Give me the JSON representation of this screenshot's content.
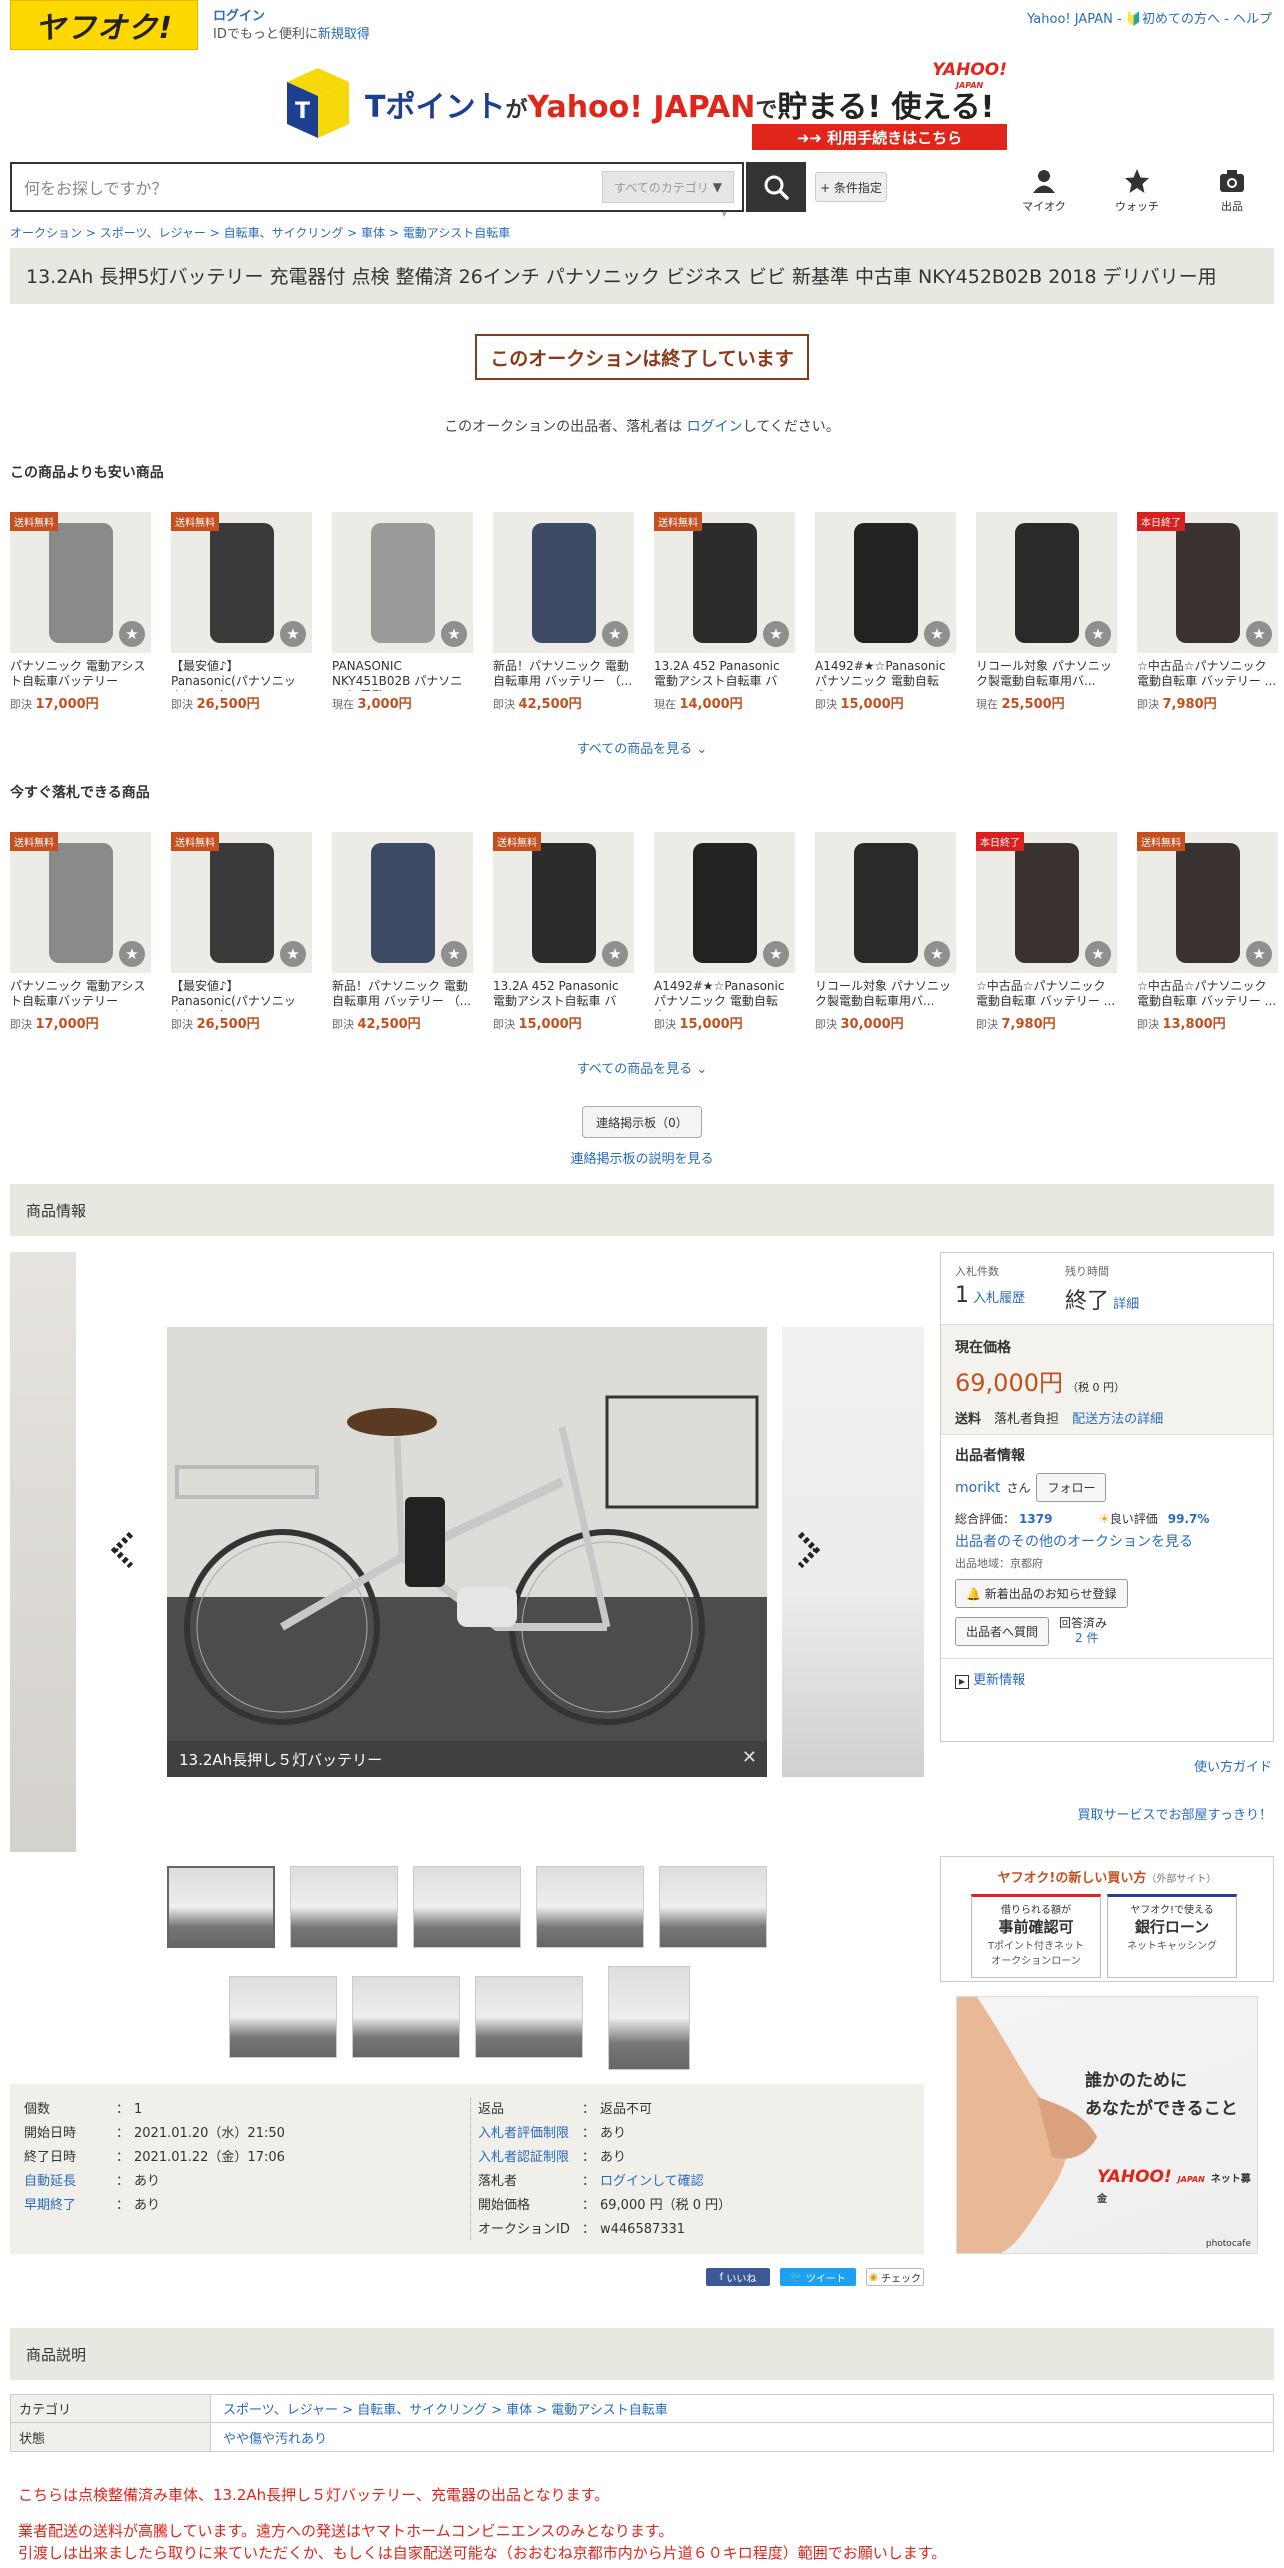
{
  "header": {
    "logo": "ヤフオク!",
    "login": "ログイン",
    "login_sub_prefix": "IDでもっと便利に",
    "login_sub_link": "新規取得",
    "links": "Yahoo! JAPAN - 🔰初めての方へ - ヘルプ"
  },
  "banner": {
    "tpoint": "Tポイント",
    "ga": "が",
    "yahoo": "Yahoo! JAPAN",
    "tame": "で",
    "tamaru": "貯まる! 使える!",
    "yahoo_logo": "YAHOO!",
    "yahoo_logo_sub": "JAPAN",
    "cta": "➜➜ 利用手続きはこちら"
  },
  "search": {
    "placeholder": "何をお探しですか？",
    "category": "すべてのカテゴリ",
    "conditions": "+ 条件指定"
  },
  "nav": {
    "mypage": "マイオク",
    "watch": "ウォッチ",
    "sell": "出品"
  },
  "breadcrumb": [
    "オークション",
    "スポーツ、レジャー",
    "自転車、サイクリング",
    "車体",
    "電動アシスト自転車"
  ],
  "title": "13.2Ah 長押5灯バッテリー 充電器付 点検 整備済 26インチ パナソニック ビジネス ビビ 新基準 中古車 NKY452B02B 2018 デリバリー用",
  "ended_label": "このオークションは終了しています",
  "notice": {
    "prefix": "このオークションの出品者、落札者は",
    "link": "ログイン",
    "suffix": "してください。"
  },
  "cheaper": {
    "heading": "この商品よりも安い商品",
    "see_all": "すべての商品を見る",
    "items": [
      {
        "badge": "送料無料",
        "name": "パナソニック 電動アシスト自転車バッテリー NKY...",
        "plabel": "即決",
        "price": "17,000円",
        "color": "#8a8a88"
      },
      {
        "badge": "送料無料",
        "name": "【最安値♪】Panasonic(パナソニック) リチウムイ...",
        "plabel": "即決",
        "price": "26,500円",
        "color": "#3a3a3a"
      },
      {
        "badge": "",
        "name": "PANASONIC NKY451B02B パナソニック 電動 ...",
        "plabel": "現在",
        "price": "3,000円",
        "color": "#9a9a98"
      },
      {
        "badge": "",
        "name": "新品！パナソニック 電動自転車用 バッテリー （...",
        "plabel": "即決",
        "price": "42,500円",
        "color": "#3c4a66"
      },
      {
        "badge": "送料無料",
        "name": "13.2A 452 Panasonic 電動アシスト自転車 バッ...",
        "plabel": "現在",
        "price": "14,000円",
        "color": "#2c2c2c"
      },
      {
        "badge": "",
        "name": "A1492#★☆Panasonic パナソニック 電動自転車...",
        "plabel": "即決",
        "price": "15,000円",
        "color": "#222"
      },
      {
        "badge": "",
        "name": "リコール対象 パナソニック製電動自転車用バ...",
        "plabel": "現在",
        "price": "25,500円",
        "color": "#2a2a2a"
      },
      {
        "badge": "本日終了",
        "name": "☆中古品☆パナソニック 電動自転車 バッテリー ...",
        "plabel": "即決",
        "price": "7,980円",
        "color": "#3a3230"
      }
    ]
  },
  "buynow": {
    "heading": "今すぐ落札できる商品",
    "see_all": "すべての商品を見る",
    "items": [
      {
        "badge": "送料無料",
        "name": "パナソニック 電動アシスト自転車バッテリー NKY...",
        "plabel": "即決",
        "price": "17,000円",
        "color": "#8a8a88"
      },
      {
        "badge": "送料無料",
        "name": "【最安値♪】Panasonic(パナソニック) リチウムイ...",
        "plabel": "即決",
        "price": "26,500円",
        "color": "#3a3a3a"
      },
      {
        "badge": "",
        "name": "新品！パナソニック 電動自転車用 バッテリー （...",
        "plabel": "即決",
        "price": "42,500円",
        "color": "#3c4a66"
      },
      {
        "badge": "送料無料",
        "name": "13.2A 452 Panasonic 電動アシスト自転車 バッ...",
        "plabel": "即決",
        "price": "15,000円",
        "color": "#2c2c2c"
      },
      {
        "badge": "",
        "name": "A1492#★☆Panasonic パナソニック 電動自転車...",
        "plabel": "即決",
        "price": "15,000円",
        "color": "#222"
      },
      {
        "badge": "",
        "name": "リコール対象 パナソニック製電動自転車用バ...",
        "plabel": "即決",
        "price": "30,000円",
        "color": "#2a2a2a"
      },
      {
        "badge": "本日終了",
        "name": "☆中古品☆パナソニック 電動自転車 バッテリー ...",
        "plabel": "即決",
        "price": "7,980円",
        "color": "#3a3230"
      },
      {
        "badge": "送料無料",
        "name": "☆中古品☆パナソニック 電動自転車 バッテリー ...",
        "plabel": "即決",
        "price": "13,800円",
        "color": "#3a3230"
      }
    ]
  },
  "bbs": {
    "button": "連絡掲示板（0）",
    "link": "連絡掲示板の説明を見る"
  },
  "item_info_heading": "商品情報",
  "photo_caption": "13.2Ah長押し５灯バッテリー",
  "panel": {
    "bids_label": "入札件数",
    "bids": "1",
    "bid_history": "入札履歴",
    "time_label": "残り時間",
    "time": "終了",
    "detail": "詳細",
    "price_label": "現在価格",
    "price": "69,000円",
    "tax": "（税 0 円）",
    "shipping_label": "送料",
    "shipping_val": "落札者負担",
    "shipping_link": "配送方法の詳細",
    "seller_heading": "出品者情報",
    "seller_name": "morikt",
    "seller_san": "さん",
    "follow": "フォロー",
    "rating_label": "総合評価：",
    "rating": "1379",
    "good_label": "良い評価",
    "good": "99.7%",
    "other_link": "出品者のその他のオークションを見る",
    "region": "出品地域：京都府",
    "notify": "新着出品のお知らせ登録",
    "ask": "出品者へ質問",
    "answered": "回答済み",
    "answered_count": "2 件",
    "update": "更新情報"
  },
  "guide_link": "使い方ガイド",
  "buy_link": "買取サービスでお部屋すっきり！",
  "newbuy": {
    "title": "ヤフオク!の新しい買い方",
    "ext": "（外部サイト）",
    "card1_top": "借りられる額が",
    "card1_main": "事前確認可",
    "card1_sub1": "Tポイント付きネット",
    "card1_sub2": "オークションローン",
    "card2_top": "ヤフオク!で使える",
    "card2_main": "銀行ローン",
    "card2_sub": "ネットキャッシング"
  },
  "ad": {
    "line1": "誰かのために",
    "line2": "あなたができること",
    "brand": "YAHOO!",
    "brand_sub": "JAPAN",
    "brand_tag": "ネット募金",
    "credit": "photocafe"
  },
  "spec": {
    "left": [
      {
        "k": "個数",
        "v": "1",
        "link": false
      },
      {
        "k": "開始日時",
        "v": "2021.01.20（水）21:50",
        "link": false
      },
      {
        "k": "終了日時",
        "v": "2021.01.22（金）17:06",
        "link": false
      },
      {
        "k": "自動延長",
        "v": "あり",
        "link": true
      },
      {
        "k": "早期終了",
        "v": "あり",
        "link": true
      }
    ],
    "right": [
      {
        "k": "返品",
        "v": "返品不可",
        "link": false,
        "vlink": false
      },
      {
        "k": "入札者評価制限",
        "v": "あり",
        "link": true,
        "vlink": false
      },
      {
        "k": "入札者認証制限",
        "v": "あり",
        "link": true,
        "vlink": false
      },
      {
        "k": "落札者",
        "v": "ログインして確認",
        "link": false,
        "vlink": true
      },
      {
        "k": "開始価格",
        "v": "69,000 円（税 0 円）",
        "link": false,
        "vlink": false
      },
      {
        "k": "オークションID",
        "v": "w446587331",
        "link": false,
        "vlink": false
      }
    ]
  },
  "social": {
    "like": "いいね",
    "tweet": "ツイート",
    "check": "チェック"
  },
  "desc_heading": "商品説明",
  "cat_table": {
    "cat_label": "カテゴリ",
    "cat_value": "スポーツ、レジャー > 自転車、サイクリング > 車体 > 電動アシスト自転車",
    "state_label": "状態",
    "state_value": "やや傷や汚れあり"
  },
  "description": [
    "こちらは点検整備済み車体、13.2Ah長押し５灯バッテリー、充電器の出品となります。",
    "業者配送の送料が高騰しています。遠方への発送はヤマトホームコンビニエンスのみとなります。",
    "引渡しは出来ましたら取りに来ていただくか、もしくは自家配送可能な（おおむね京都市内から片道６０キロ程度）範囲でお願いします。"
  ]
}
